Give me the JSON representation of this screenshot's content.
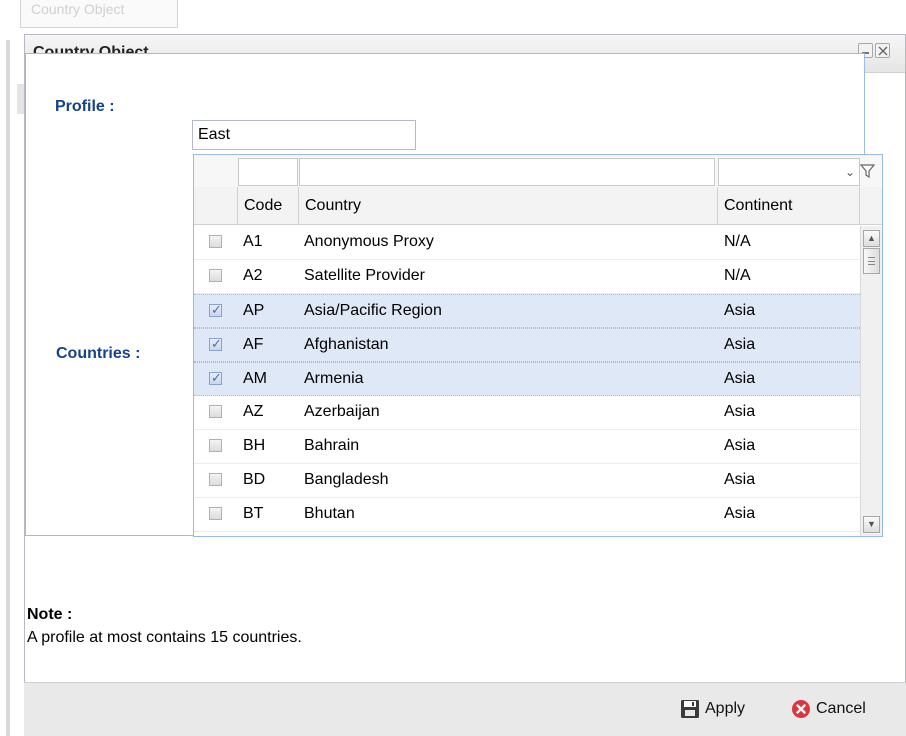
{
  "background": {
    "tab_label": "Country Object"
  },
  "window": {
    "title": "Country Object",
    "minimize_icon": "minimize-icon",
    "close_icon": "close-icon"
  },
  "form": {
    "profile_label": "Profile :",
    "profile_value": "East",
    "countries_label": "Countries :"
  },
  "grid": {
    "headers": {
      "code": "Code",
      "country": "Country",
      "continent": "Continent"
    },
    "filter_icon": "filter-icon",
    "rows": [
      {
        "code": "A1",
        "country": "Anonymous Proxy",
        "continent": "N/A",
        "checked": false
      },
      {
        "code": "A2",
        "country": "Satellite Provider",
        "continent": "N/A",
        "checked": false
      },
      {
        "code": "AP",
        "country": "Asia/Pacific Region",
        "continent": "Asia",
        "checked": true
      },
      {
        "code": "AF",
        "country": "Afghanistan",
        "continent": "Asia",
        "checked": true
      },
      {
        "code": "AM",
        "country": "Armenia",
        "continent": "Asia",
        "checked": true
      },
      {
        "code": "AZ",
        "country": "Azerbaijan",
        "continent": "Asia",
        "checked": false
      },
      {
        "code": "BH",
        "country": "Bahrain",
        "continent": "Asia",
        "checked": false
      },
      {
        "code": "BD",
        "country": "Bangladesh",
        "continent": "Asia",
        "checked": false
      },
      {
        "code": "BT",
        "country": "Bhutan",
        "continent": "Asia",
        "checked": false
      }
    ]
  },
  "note": {
    "label": "Note :",
    "text": "A profile at most contains 15 countries."
  },
  "footer": {
    "apply_label": "Apply",
    "cancel_label": "Cancel",
    "apply_icon": "save-icon",
    "cancel_icon": "cancel-icon"
  },
  "colors": {
    "label_blue": "#15428b",
    "selected_row": "#dfe8f6",
    "panel_border": "#99bbe8",
    "cancel_red": "#d9363e"
  }
}
